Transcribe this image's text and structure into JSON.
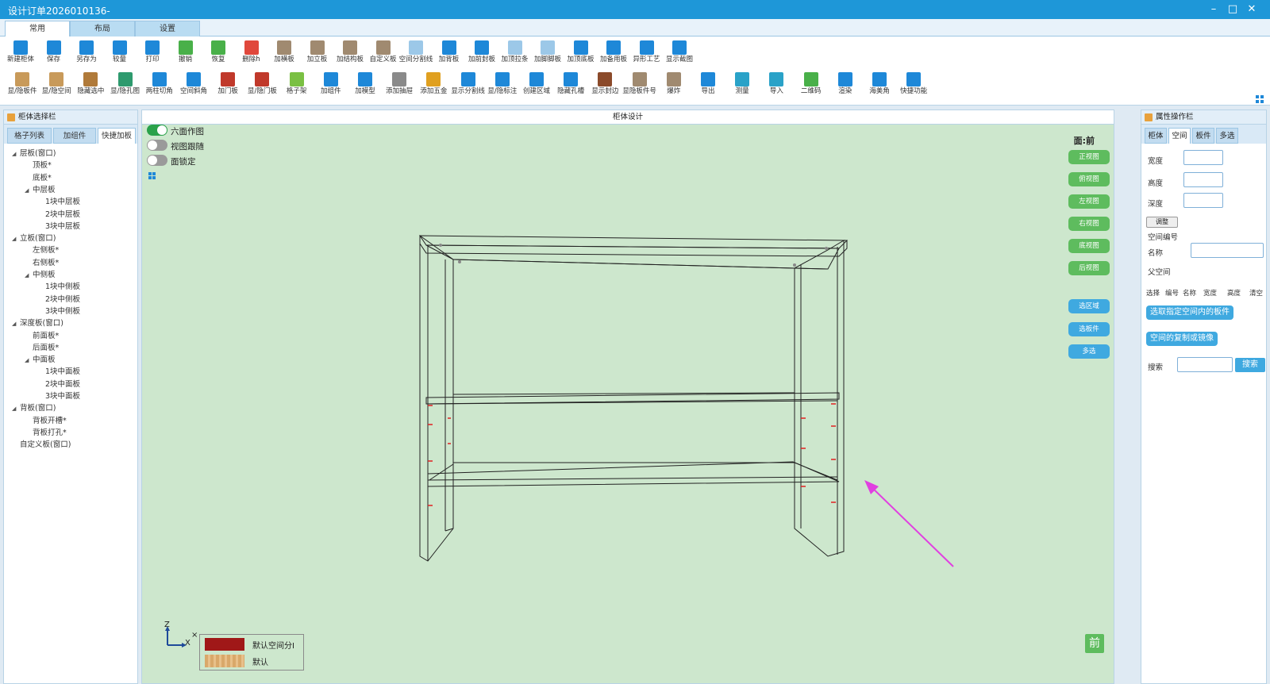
{
  "window": {
    "title": "设计订单2026010136-",
    "minimize": "–",
    "maximize": "□",
    "close": "✕"
  },
  "ribbon_tabs": [
    "常用",
    "布局",
    "设置"
  ],
  "toolbar_row1": [
    {
      "label": "新建柜体",
      "color": "#1e88d8"
    },
    {
      "label": "保存",
      "color": "#1e88d8"
    },
    {
      "label": "另存为",
      "color": "#1e88d8"
    },
    {
      "label": "较量",
      "color": "#1e88d8"
    },
    {
      "label": "打印",
      "color": "#1e88d8"
    },
    {
      "label": "撤销",
      "color": "#49b049"
    },
    {
      "label": "恢复",
      "color": "#49b049"
    },
    {
      "label": "删除h",
      "color": "#e0483c"
    },
    {
      "label": "加横板",
      "color": "#a08a70"
    },
    {
      "label": "加立板",
      "color": "#a08a70"
    },
    {
      "label": "加结构板",
      "color": "#a08a70"
    },
    {
      "label": "自定义板",
      "color": "#a08a70"
    },
    {
      "label": "空间分割线",
      "color": "#9cc8e8"
    },
    {
      "label": "加背板",
      "color": "#1e88d8"
    },
    {
      "label": "加前封板",
      "color": "#1e88d8"
    },
    {
      "label": "加顶拉条",
      "color": "#9cc8e8"
    },
    {
      "label": "加脚脚板",
      "color": "#9cc8e8"
    },
    {
      "label": "加顶底板",
      "color": "#1e88d8"
    },
    {
      "label": "加备用板",
      "color": "#1e88d8"
    },
    {
      "label": "异形工艺",
      "color": "#1e88d8"
    },
    {
      "label": "显示截图",
      "color": "#1e88d8"
    }
  ],
  "toolbar_row2": [
    {
      "label": "显/隐板件",
      "color": "#c89a5a"
    },
    {
      "label": "显/隐空间",
      "color": "#c89a5a"
    },
    {
      "label": "隐藏选中",
      "color": "#b07a3a"
    },
    {
      "label": "显/隐孔图",
      "color": "#2e9a6e"
    },
    {
      "label": "两柱切角",
      "color": "#1e88d8"
    },
    {
      "label": "空间斜角",
      "color": "#1e88d8"
    },
    {
      "label": "加门板",
      "color": "#c0392b"
    },
    {
      "label": "显/隐门板",
      "color": "#c0392b"
    },
    {
      "label": "格子架",
      "color": "#7ac043"
    },
    {
      "label": "加组件",
      "color": "#1e88d8"
    },
    {
      "label": "加模型",
      "color": "#1e88d8"
    },
    {
      "label": "添加抽屉",
      "color": "#8a8a8a"
    },
    {
      "label": "添加五金",
      "color": "#e0a020"
    },
    {
      "label": "显示分割线",
      "color": "#1e88d8"
    },
    {
      "label": "显/隐标注",
      "color": "#1e88d8"
    },
    {
      "label": "创建区域",
      "color": "#1e88d8"
    },
    {
      "label": "隐藏孔槽",
      "color": "#1e88d8"
    },
    {
      "label": "显示封边",
      "color": "#8b4a2a"
    },
    {
      "label": "显隐板件号",
      "color": "#a08a70"
    },
    {
      "label": "爆炸",
      "color": "#a08a70"
    },
    {
      "label": "导出",
      "color": "#1e88d8"
    },
    {
      "label": "测量",
      "color": "#2aa2c8"
    },
    {
      "label": "导入",
      "color": "#2aa2c8"
    },
    {
      "label": "二维码",
      "color": "#49b049"
    },
    {
      "label": "渲染",
      "color": "#1e88d8"
    },
    {
      "label": "海美角",
      "color": "#1e88d8"
    },
    {
      "label": "快捷功能",
      "color": "#1e88d8"
    }
  ],
  "left_panel": {
    "title": "柜体选择栏",
    "tabs": [
      "格子列表",
      "加组件",
      "快捷加板"
    ],
    "tree": [
      {
        "text": "层板(窗口)",
        "level": 0,
        "arrow": true
      },
      {
        "text": "顶板*",
        "level": 1,
        "arrow": false
      },
      {
        "text": "底板*",
        "level": 1,
        "arrow": false
      },
      {
        "text": "中层板",
        "level": 1,
        "arrow": true
      },
      {
        "text": "1块中层板",
        "level": 2,
        "arrow": false
      },
      {
        "text": "2块中层板",
        "level": 2,
        "arrow": false
      },
      {
        "text": "3块中层板",
        "level": 2,
        "arrow": false
      },
      {
        "text": "立板(窗口)",
        "level": 0,
        "arrow": true
      },
      {
        "text": "左侧板*",
        "level": 1,
        "arrow": false
      },
      {
        "text": "右侧板*",
        "level": 1,
        "arrow": false
      },
      {
        "text": "中侧板",
        "level": 1,
        "arrow": true
      },
      {
        "text": "1块中侧板",
        "level": 2,
        "arrow": false
      },
      {
        "text": "2块中侧板",
        "level": 2,
        "arrow": false
      },
      {
        "text": "3块中侧板",
        "level": 2,
        "arrow": false
      },
      {
        "text": "深度板(窗口)",
        "level": 0,
        "arrow": true
      },
      {
        "text": "前面板*",
        "level": 1,
        "arrow": false
      },
      {
        "text": "后面板*",
        "level": 1,
        "arrow": false
      },
      {
        "text": "中面板",
        "level": 1,
        "arrow": true
      },
      {
        "text": "1块中面板",
        "level": 2,
        "arrow": false
      },
      {
        "text": "2块中面板",
        "level": 2,
        "arrow": false
      },
      {
        "text": "3块中面板",
        "level": 2,
        "arrow": false
      },
      {
        "text": "背板(窗口)",
        "level": 0,
        "arrow": true
      },
      {
        "text": "背板开槽*",
        "level": 1,
        "arrow": false
      },
      {
        "text": "背板打孔*",
        "level": 1,
        "arrow": false
      },
      {
        "text": "自定义板(窗口)",
        "level": 0,
        "arrow": false
      }
    ]
  },
  "center": {
    "title": "柜体设计",
    "toggles": [
      {
        "label": "六面作图",
        "on": true
      },
      {
        "label": "视图跟随",
        "on": false
      },
      {
        "label": "面锁定",
        "on": false
      }
    ],
    "face_label": "面:前",
    "view_buttons": [
      "正视图",
      "俯视图",
      "左视图",
      "右视图",
      "底视图",
      "后视图"
    ],
    "select_buttons": [
      "选区域",
      "选板件",
      "多选"
    ],
    "axis": {
      "z": "Z",
      "x": "X",
      "y": "×"
    },
    "legend": [
      {
        "label": "默认空间分I",
        "color": "#a01818"
      },
      {
        "label": "默认",
        "color": "#d9a86a"
      }
    ],
    "front_button": "前"
  },
  "right_panel": {
    "title": "属性操作栏",
    "tabs": [
      "柜体",
      "空间",
      "板件",
      "多选"
    ],
    "width_label": "宽度",
    "height_label": "高度",
    "depth_label": "深度",
    "adjust_button": "调整",
    "space_id_label": "空间编号",
    "name_label": "名称",
    "parent_label": "父空间",
    "columns": [
      "选择",
      "编号",
      "名称",
      "宽度",
      "高度",
      "清空"
    ],
    "select_boards_button": "选取指定空间内的板件",
    "copy_mirror_button": "空间的复制或镜像",
    "search_label": "搜索",
    "search_button": "搜索"
  }
}
